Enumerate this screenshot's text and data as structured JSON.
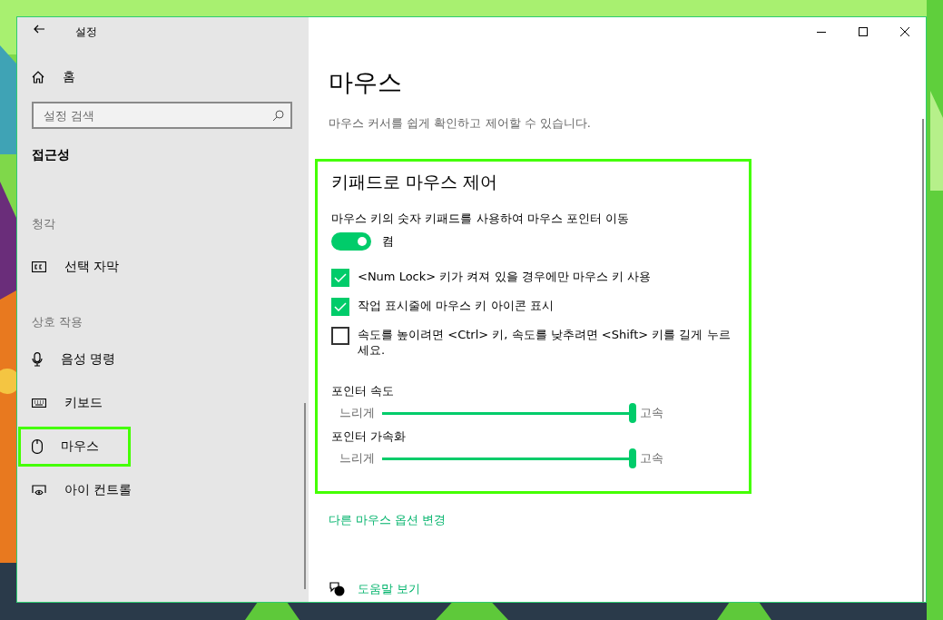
{
  "window": {
    "title": "설정"
  },
  "sidebar": {
    "home": "홈",
    "search": {
      "placeholder": "설정 검색"
    },
    "category": "접근성",
    "groups": [
      {
        "heading": "청각",
        "items": [
          {
            "label": "선택 자막",
            "highlighted": false
          }
        ]
      },
      {
        "heading": "상호 작용",
        "items": [
          {
            "label": "음성 명령",
            "highlighted": false
          },
          {
            "label": "키보드",
            "highlighted": false
          },
          {
            "label": "마우스",
            "highlighted": true
          },
          {
            "label": "아이 컨트롤",
            "highlighted": false
          }
        ]
      }
    ]
  },
  "page": {
    "title": "마우스",
    "description": "마우스 커서를 쉽게 확인하고 제어할 수 있습니다.",
    "section": {
      "title": "키패드로 마우스 제어",
      "highlighted": true,
      "toggle": {
        "label": "마우스 키의 숫자 키패드를 사용하여 마우스 포인터 이동",
        "on": true,
        "state_text": "켬"
      },
      "checkboxes": [
        {
          "label": "<Num Lock> 키가 켜져 있을 경우에만 마우스 키 사용",
          "checked": true
        },
        {
          "label": "작업 표시줄에 마우스 키 아이콘 표시",
          "checked": true
        },
        {
          "label": "속도를 높이려면 <Ctrl> 키, 속도를 낮추려면 <Shift> 키를 길게 누르세요.",
          "checked": false
        }
      ],
      "sliders": [
        {
          "label": "포인터 속도",
          "min_label": "느리게",
          "max_label": "고속",
          "level": 1.0
        },
        {
          "label": "포인터 가속화",
          "min_label": "느리게",
          "max_label": "고속",
          "level": 1.0
        }
      ]
    },
    "link": "다른 마우스 옵션 변경",
    "help": "도움말 보기"
  }
}
